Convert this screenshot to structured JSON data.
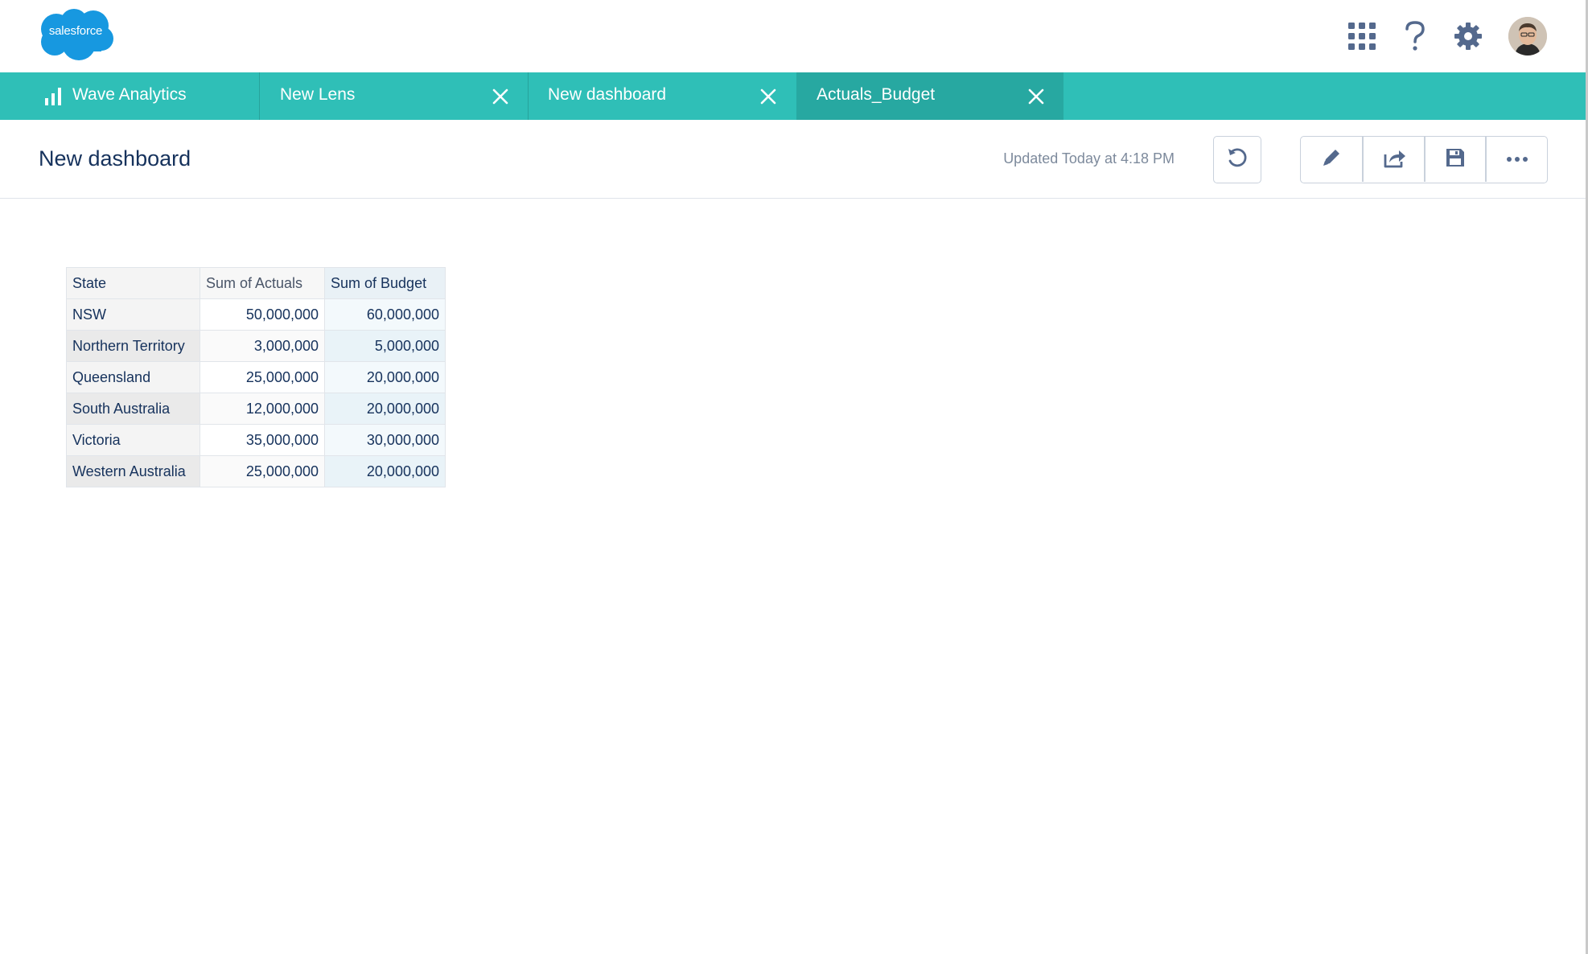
{
  "header": {
    "logo_text": "salesforce",
    "icons": [
      "app-launcher-icon",
      "help-icon",
      "gear-icon",
      "avatar"
    ]
  },
  "tabs": [
    {
      "label": "Wave Analytics",
      "icon": "bar-chart-icon",
      "closable": false,
      "active": false
    },
    {
      "label": "New Lens",
      "closable": true,
      "active": false
    },
    {
      "label": "New dashboard",
      "closable": true,
      "active": false
    },
    {
      "label": "Actuals_Budget",
      "closable": true,
      "active": true
    }
  ],
  "page": {
    "title": "New dashboard",
    "updated": "Updated Today at 4:18 PM",
    "buttons": [
      "undo-icon",
      "pencil-icon",
      "share-icon",
      "save-icon",
      "more-icon"
    ]
  },
  "table": {
    "headers": [
      "State",
      "Sum of Actuals",
      "Sum of Budget"
    ],
    "rows": [
      {
        "state": "NSW",
        "actuals": "50,000,000",
        "budget": "60,000,000"
      },
      {
        "state": "Northern Territory",
        "actuals": "3,000,000",
        "budget": "5,000,000"
      },
      {
        "state": "Queensland",
        "actuals": "25,000,000",
        "budget": "20,000,000"
      },
      {
        "state": "South Australia",
        "actuals": "12,000,000",
        "budget": "20,000,000"
      },
      {
        "state": "Victoria",
        "actuals": "35,000,000",
        "budget": "30,000,000"
      },
      {
        "state": "Western Australia",
        "actuals": "25,000,000",
        "budget": "20,000,000"
      }
    ]
  },
  "colors": {
    "tab_bar": "#2fbfb7",
    "tab_active": "#27a8a1",
    "logo_blue": "#1798e0",
    "icon_gray": "#54698d"
  }
}
